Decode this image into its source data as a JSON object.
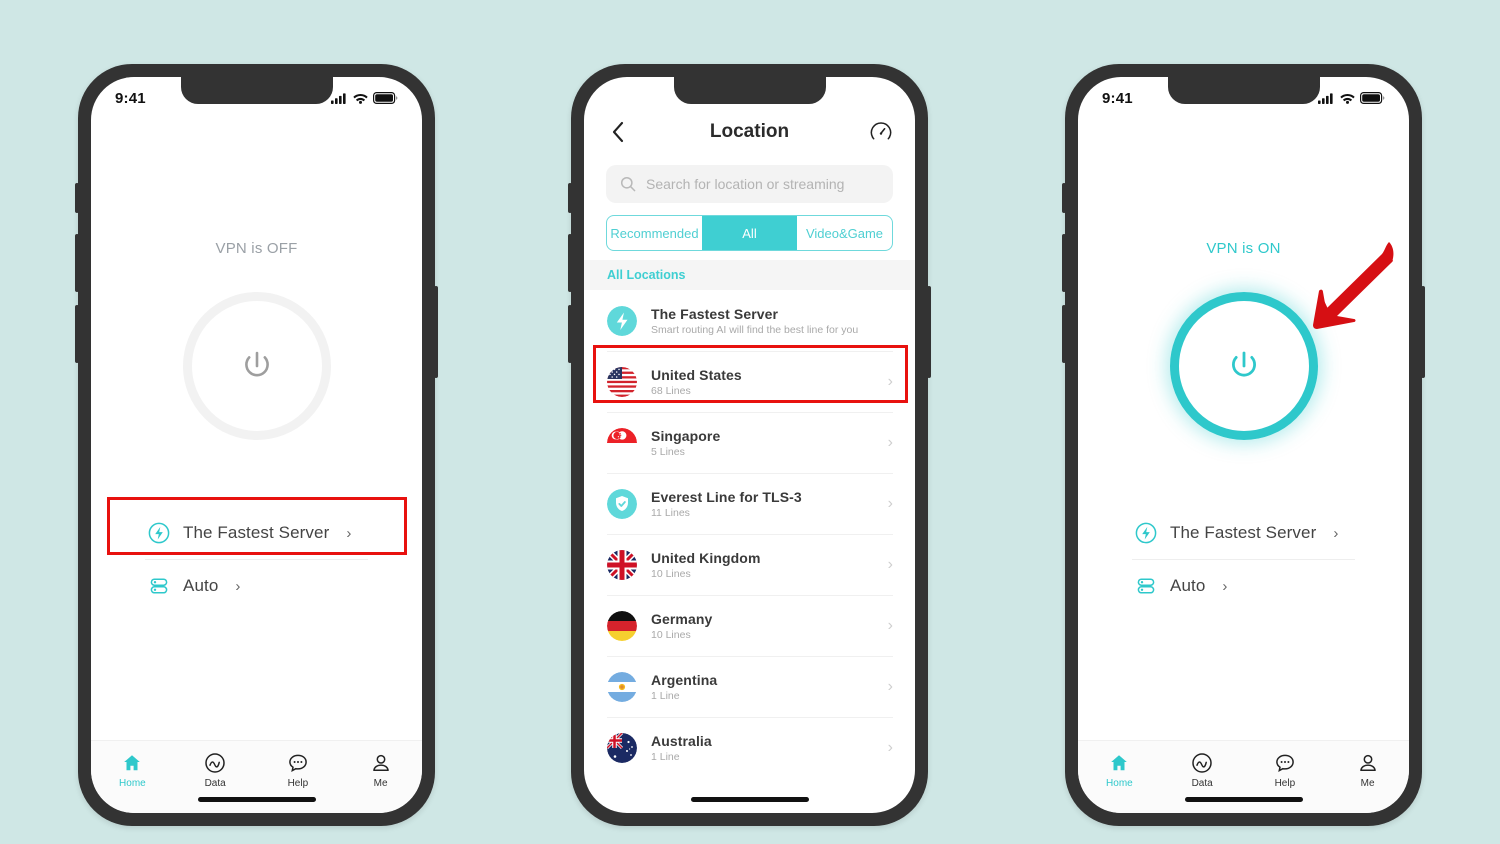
{
  "canvas": {
    "background": "#cfe7e5"
  },
  "theme": {
    "accent": "#2ec8cb",
    "accent_light": "#3fcfd2",
    "highlight": "#e8110f",
    "muted": "#9aa0a6"
  },
  "phones": {
    "one": {
      "status": {
        "time": "9:41",
        "signal_icon": "cellular-signal-icon",
        "wifi_icon": "wifi-icon",
        "battery_icon": "battery-icon"
      },
      "vpn_state_label": "VPN is OFF",
      "power_icon": "power-icon",
      "options": [
        {
          "icon": "fastest-server-icon",
          "label": "The Fastest Server",
          "chevron": "›"
        },
        {
          "icon": "server-stack-icon",
          "label": "Auto",
          "chevron": "›"
        }
      ],
      "highlight_target": "The Fastest Server",
      "tabs": [
        {
          "label": "Home",
          "icon": "home-icon",
          "active": true
        },
        {
          "label": "Data",
          "icon": "data-chart-icon",
          "active": false
        },
        {
          "label": "Help",
          "icon": "help-chat-icon",
          "active": false
        },
        {
          "label": "Me",
          "icon": "person-icon",
          "active": false
        }
      ]
    },
    "two": {
      "header": {
        "back_icon": "back-chevron-icon",
        "title": "Location",
        "speed_icon": "speedometer-icon"
      },
      "search": {
        "icon": "search-icon",
        "placeholder": "Search for location or streaming",
        "value": ""
      },
      "segments": [
        {
          "label": "Recommended",
          "active": false
        },
        {
          "label": "All",
          "active": true
        },
        {
          "label": "Video&Game",
          "active": false
        }
      ],
      "section_title": "All Locations",
      "locations": [
        {
          "icon": "fastest-server-badge-icon",
          "name": "The Fastest Server",
          "sub": "Smart routing AI will find the best line for you",
          "chevron": "",
          "highlighted": false
        },
        {
          "icon": "flag-us",
          "name": "United States",
          "sub": "68 Lines",
          "chevron": "›",
          "highlighted": true
        },
        {
          "icon": "flag-sg",
          "name": "Singapore",
          "sub": "5 Lines",
          "chevron": "›",
          "highlighted": false
        },
        {
          "icon": "shield-check-icon",
          "name": "Everest Line for TLS-3",
          "sub": "11 Lines",
          "chevron": "›",
          "highlighted": false
        },
        {
          "icon": "flag-uk",
          "name": "United Kingdom",
          "sub": "10 Lines",
          "chevron": "›",
          "highlighted": false
        },
        {
          "icon": "flag-de",
          "name": "Germany",
          "sub": "10 Lines",
          "chevron": "›",
          "highlighted": false
        },
        {
          "icon": "flag-ar",
          "name": "Argentina",
          "sub": "1 Line",
          "chevron": "›",
          "highlighted": false
        },
        {
          "icon": "flag-au",
          "name": "Australia",
          "sub": "1 Line",
          "chevron": "›",
          "highlighted": false
        }
      ]
    },
    "three": {
      "status": {
        "time": "9:41",
        "signal_icon": "cellular-signal-icon",
        "wifi_icon": "wifi-icon",
        "battery_icon": "battery-icon"
      },
      "vpn_state_label": "VPN is ON",
      "power_icon": "power-icon",
      "annotation_icon": "red-arrow-icon",
      "options": [
        {
          "icon": "fastest-server-icon",
          "label": "The Fastest Server",
          "chevron": "›"
        },
        {
          "icon": "server-stack-icon",
          "label": "Auto",
          "chevron": "›"
        }
      ],
      "tabs": [
        {
          "label": "Home",
          "icon": "home-icon",
          "active": true
        },
        {
          "label": "Data",
          "icon": "data-chart-icon",
          "active": false
        },
        {
          "label": "Help",
          "icon": "help-chat-icon",
          "active": false
        },
        {
          "label": "Me",
          "icon": "person-icon",
          "active": false
        }
      ]
    }
  }
}
